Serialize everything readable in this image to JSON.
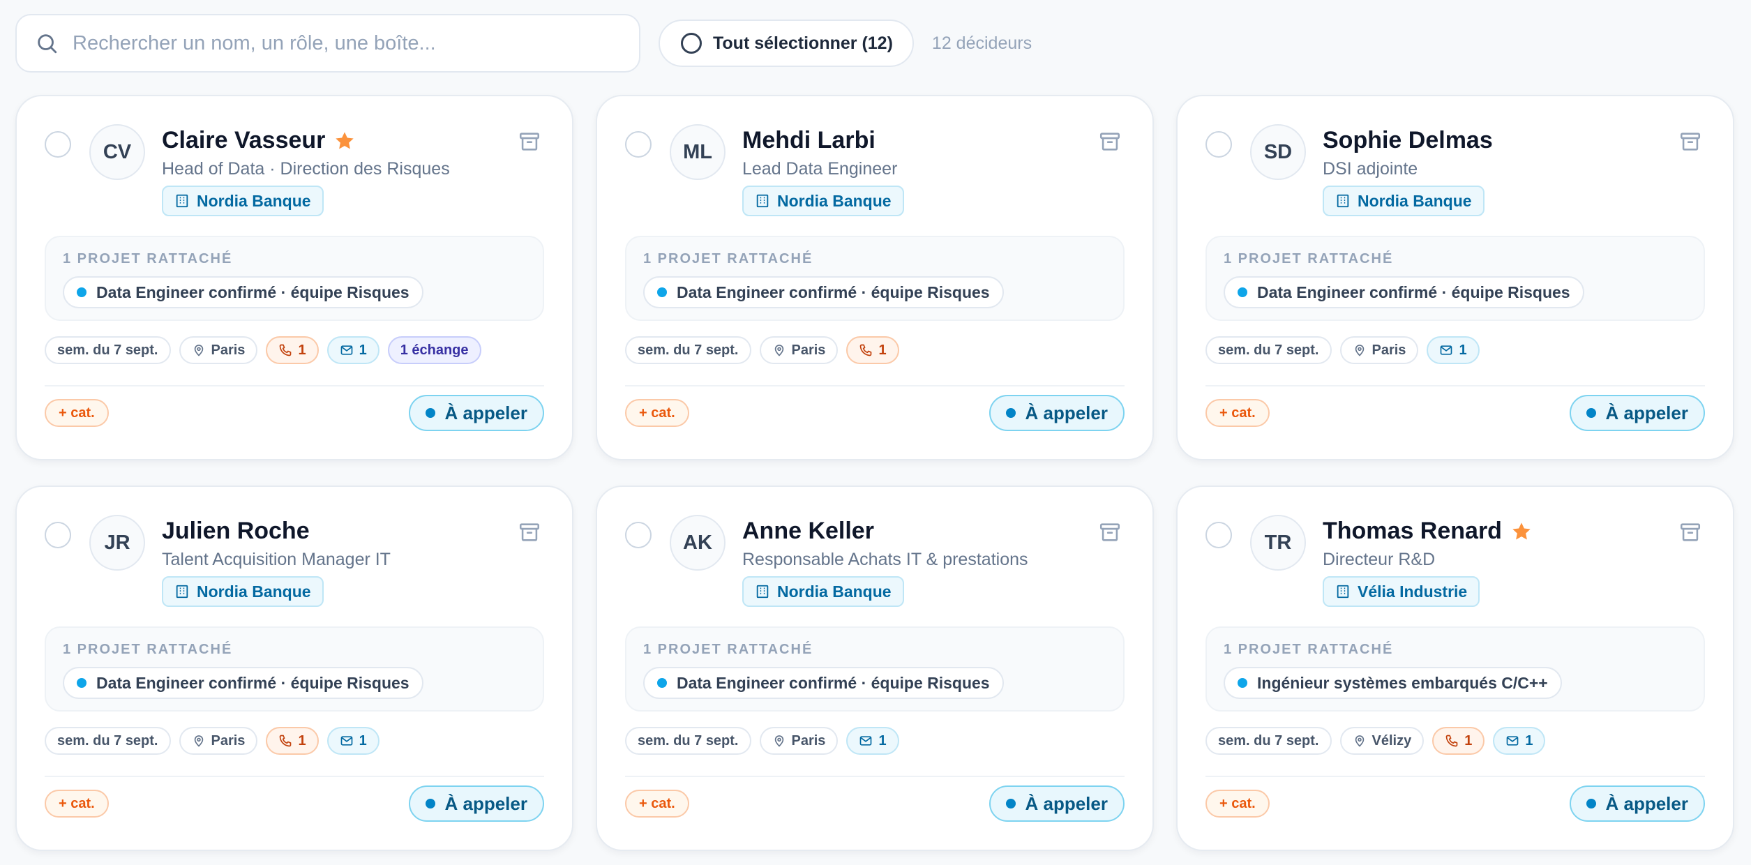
{
  "search": {
    "placeholder": "Rechercher un nom, un rôle, une boîte...",
    "value": ""
  },
  "select_all_label": "Tout sélectionner (12)",
  "count_label": "12 décideurs",
  "colors": {
    "accent": "#0ea5e9",
    "star": "#fb923c",
    "call": "#c2410c",
    "mail": "#0369a1",
    "exchange": "#3730a3"
  },
  "cards": [
    {
      "initials": "CV",
      "name": "Claire Vasseur",
      "starred": true,
      "role": "Head of Data · Direction des Risques",
      "company": "Nordia Banque",
      "projects_title": "1 PROJET RATTACHÉ",
      "project": "Data Engineer confirmé · équipe Risques",
      "week": "sem. du 7 sept.",
      "location": "Paris",
      "calls": "1",
      "mails": "1",
      "exchanges": "1 échange",
      "cat_label": "+ cat.",
      "status": "À appeler"
    },
    {
      "initials": "ML",
      "name": "Mehdi Larbi",
      "starred": false,
      "role": "Lead Data Engineer",
      "company": "Nordia Banque",
      "projects_title": "1 PROJET RATTACHÉ",
      "project": "Data Engineer confirmé · équipe Risques",
      "week": "sem. du 7 sept.",
      "location": "Paris",
      "calls": "1",
      "mails": "",
      "exchanges": "",
      "cat_label": "+ cat.",
      "status": "À appeler"
    },
    {
      "initials": "SD",
      "name": "Sophie Delmas",
      "starred": false,
      "role": "DSI adjointe",
      "company": "Nordia Banque",
      "projects_title": "1 PROJET RATTACHÉ",
      "project": "Data Engineer confirmé · équipe Risques",
      "week": "sem. du 7 sept.",
      "location": "Paris",
      "calls": "",
      "mails": "1",
      "exchanges": "",
      "cat_label": "+ cat.",
      "status": "À appeler"
    },
    {
      "initials": "JR",
      "name": "Julien Roche",
      "starred": false,
      "role": "Talent Acquisition Manager IT",
      "company": "Nordia Banque",
      "projects_title": "1 PROJET RATTACHÉ",
      "project": "Data Engineer confirmé · équipe Risques",
      "week": "sem. du 7 sept.",
      "location": "Paris",
      "calls": "1",
      "mails": "1",
      "exchanges": "",
      "cat_label": "+ cat.",
      "status": "À appeler"
    },
    {
      "initials": "AK",
      "name": "Anne Keller",
      "starred": false,
      "role": "Responsable Achats IT & prestations",
      "company": "Nordia Banque",
      "projects_title": "1 PROJET RATTACHÉ",
      "project": "Data Engineer confirmé · équipe Risques",
      "week": "sem. du 7 sept.",
      "location": "Paris",
      "calls": "",
      "mails": "1",
      "exchanges": "",
      "cat_label": "+ cat.",
      "status": "À appeler"
    },
    {
      "initials": "TR",
      "name": "Thomas Renard",
      "starred": true,
      "role": "Directeur R&D",
      "company": "Vélia Industrie",
      "projects_title": "1 PROJET RATTACHÉ",
      "project": "Ingénieur systèmes embarqués C/C++",
      "week": "sem. du 7 sept.",
      "location": "Vélizy",
      "calls": "1",
      "mails": "1",
      "exchanges": "",
      "cat_label": "+ cat.",
      "status": "À appeler"
    }
  ]
}
